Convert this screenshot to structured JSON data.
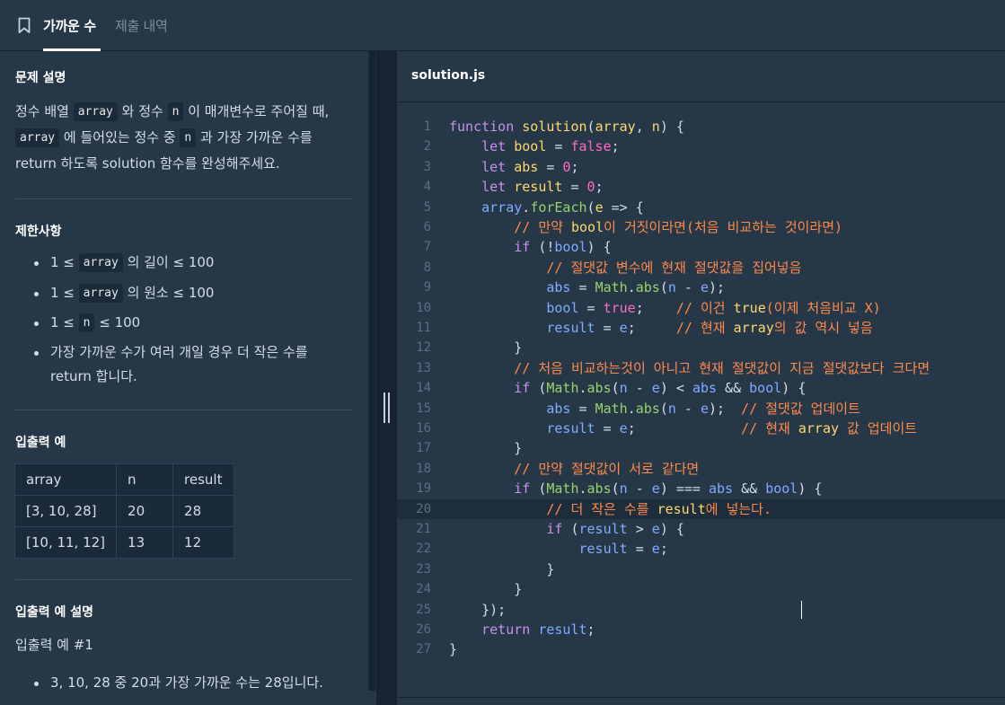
{
  "tabs": {
    "active": "가까운 수",
    "inactive": "제출 내역"
  },
  "problem": {
    "desc_title": "문제 설명",
    "desc_line1": [
      "정수 배열 ",
      "array",
      " 와 정수 ",
      "n",
      " 이 매개변수로 주어질 때,"
    ],
    "desc_line2": [
      "array",
      " 에 들어있는 정수 중 ",
      "n",
      " 과 가장 가까운 수를"
    ],
    "desc_line3": "return 하도록 solution 함수를 완성해주세요.",
    "constraints_title": "제한사항",
    "c1": [
      "1 ≤ ",
      "array",
      " 의 길이 ≤ 100"
    ],
    "c2": [
      "1 ≤ ",
      "array",
      " 의 원소 ≤ 100"
    ],
    "c3": [
      "1 ≤ ",
      "n",
      " ≤ 100"
    ],
    "c4a": "가장 가까운 수가 여러 개일 경우 더 작은 수를",
    "c4b": "return 합니다.",
    "io_title": "입출력 예",
    "io_table": [
      [
        "array",
        "n",
        "result"
      ],
      [
        "[3, 10, 28]",
        "20",
        "28"
      ],
      [
        "[10, 11, 12]",
        "13",
        "12"
      ]
    ],
    "io_expl_title": "입출력 예 설명",
    "io_expl_sub": "입출력 예 #1",
    "io_expl_item": "3, 10, 28 중 20과 가장 가까운 수는 28입니다."
  },
  "editor": {
    "file_name": "solution.js",
    "active_line": 20,
    "colors": {
      "keyword": "#c792ea",
      "function": "#ffd86e",
      "param": "#ffd86e",
      "var": "#ffd86e",
      "boolean": "#ff6bc1",
      "number": "#ff6bc1",
      "comment": "#ff8a4c",
      "builtin": "#9ad36a",
      "ident": "#82aaff",
      "plain": "#d5dde6"
    },
    "lines": [
      [
        [
          "kw",
          "function"
        ],
        [
          "pl",
          " "
        ],
        [
          "fn",
          "solution"
        ],
        [
          "pl",
          "("
        ],
        [
          "pa",
          "array"
        ],
        [
          "pl",
          ", "
        ],
        [
          "pa",
          "n"
        ],
        [
          "pl",
          ") {"
        ]
      ],
      [
        [
          "pl",
          "    "
        ],
        [
          "kw",
          "let"
        ],
        [
          "pl",
          " "
        ],
        [
          "va",
          "bool"
        ],
        [
          "pl",
          " = "
        ],
        [
          "bo",
          "false"
        ],
        [
          "pl",
          ";"
        ]
      ],
      [
        [
          "pl",
          "    "
        ],
        [
          "kw",
          "let"
        ],
        [
          "pl",
          " "
        ],
        [
          "va",
          "abs"
        ],
        [
          "pl",
          " = "
        ],
        [
          "nu",
          "0"
        ],
        [
          "pl",
          ";"
        ]
      ],
      [
        [
          "pl",
          "    "
        ],
        [
          "kw",
          "let"
        ],
        [
          "pl",
          " "
        ],
        [
          "va",
          "result"
        ],
        [
          "pl",
          " = "
        ],
        [
          "nu",
          "0"
        ],
        [
          "pl",
          ";"
        ]
      ],
      [
        [
          "pl",
          "    "
        ],
        [
          "id",
          "array"
        ],
        [
          "pl",
          "."
        ],
        [
          "bi",
          "forEach"
        ],
        [
          "pl",
          "("
        ],
        [
          "pa",
          "e"
        ],
        [
          "pl",
          " => {"
        ]
      ],
      [
        [
          "pl",
          "        "
        ],
        [
          "co",
          "// 만약 "
        ],
        [
          "va",
          "bool"
        ],
        [
          "co",
          "이 거짓이라면(처음 비교하는 것이라면)"
        ]
      ],
      [
        [
          "pl",
          "        "
        ],
        [
          "kw",
          "if"
        ],
        [
          "pl",
          " (!"
        ],
        [
          "id",
          "bool"
        ],
        [
          "pl",
          ") {"
        ]
      ],
      [
        [
          "pl",
          "            "
        ],
        [
          "co",
          "// 절댓값 변수에 현재 절댓값을 집어넣음"
        ]
      ],
      [
        [
          "pl",
          "            "
        ],
        [
          "id",
          "abs"
        ],
        [
          "pl",
          " = "
        ],
        [
          "bi",
          "Math"
        ],
        [
          "pl",
          "."
        ],
        [
          "bi",
          "abs"
        ],
        [
          "pl",
          "("
        ],
        [
          "id",
          "n"
        ],
        [
          "pl",
          " - "
        ],
        [
          "id",
          "e"
        ],
        [
          "pl",
          ");"
        ]
      ],
      [
        [
          "pl",
          "            "
        ],
        [
          "id",
          "bool"
        ],
        [
          "pl",
          " = "
        ],
        [
          "bo",
          "true"
        ],
        [
          "pl",
          ";    "
        ],
        [
          "co",
          "// 이건 "
        ],
        [
          "va",
          "true"
        ],
        [
          "co",
          "(이제 처음비교 X)"
        ]
      ],
      [
        [
          "pl",
          "            "
        ],
        [
          "id",
          "result"
        ],
        [
          "pl",
          " = "
        ],
        [
          "id",
          "e"
        ],
        [
          "pl",
          ";     "
        ],
        [
          "co",
          "// 현재 "
        ],
        [
          "va",
          "array"
        ],
        [
          "co",
          "의 값 역시 넣음"
        ]
      ],
      [
        [
          "pl",
          "        }"
        ]
      ],
      [
        [
          "pl",
          "        "
        ],
        [
          "co",
          "// 처음 비교하는것이 아니고 현재 절댓값이 지금 절댓값보다 크다면"
        ]
      ],
      [
        [
          "pl",
          "        "
        ],
        [
          "kw",
          "if"
        ],
        [
          "pl",
          " ("
        ],
        [
          "bi",
          "Math"
        ],
        [
          "pl",
          "."
        ],
        [
          "bi",
          "abs"
        ],
        [
          "pl",
          "("
        ],
        [
          "id",
          "n"
        ],
        [
          "pl",
          " - "
        ],
        [
          "id",
          "e"
        ],
        [
          "pl",
          ") < "
        ],
        [
          "id",
          "abs"
        ],
        [
          "pl",
          " && "
        ],
        [
          "id",
          "bool"
        ],
        [
          "pl",
          ") {"
        ]
      ],
      [
        [
          "pl",
          "            "
        ],
        [
          "id",
          "abs"
        ],
        [
          "pl",
          " = "
        ],
        [
          "bi",
          "Math"
        ],
        [
          "pl",
          "."
        ],
        [
          "bi",
          "abs"
        ],
        [
          "pl",
          "("
        ],
        [
          "id",
          "n"
        ],
        [
          "pl",
          " - "
        ],
        [
          "id",
          "e"
        ],
        [
          "pl",
          ");  "
        ],
        [
          "co",
          "// 절댓값 업데이트"
        ]
      ],
      [
        [
          "pl",
          "            "
        ],
        [
          "id",
          "result"
        ],
        [
          "pl",
          " = "
        ],
        [
          "id",
          "e"
        ],
        [
          "pl",
          ";             "
        ],
        [
          "co",
          "// 현재 "
        ],
        [
          "va",
          "array"
        ],
        [
          "co",
          " 값 업데이트"
        ]
      ],
      [
        [
          "pl",
          "        }"
        ]
      ],
      [
        [
          "pl",
          "        "
        ],
        [
          "co",
          "// 만약 절댓값이 서로 같다면"
        ]
      ],
      [
        [
          "pl",
          "        "
        ],
        [
          "kw",
          "if"
        ],
        [
          "pl",
          " ("
        ],
        [
          "bi",
          "Math"
        ],
        [
          "pl",
          "."
        ],
        [
          "bi",
          "abs"
        ],
        [
          "pl",
          "("
        ],
        [
          "id",
          "n"
        ],
        [
          "pl",
          " - "
        ],
        [
          "id",
          "e"
        ],
        [
          "pl",
          ") === "
        ],
        [
          "id",
          "abs"
        ],
        [
          "pl",
          " && "
        ],
        [
          "id",
          "bool"
        ],
        [
          "pl",
          ") {"
        ]
      ],
      [
        [
          "pl",
          "            "
        ],
        [
          "co",
          "// 더 작은 수를 "
        ],
        [
          "va",
          "result"
        ],
        [
          "co",
          "에 넣는다."
        ]
      ],
      [
        [
          "pl",
          "            "
        ],
        [
          "kw",
          "if"
        ],
        [
          "pl",
          " ("
        ],
        [
          "id",
          "result"
        ],
        [
          "pl",
          " > "
        ],
        [
          "id",
          "e"
        ],
        [
          "pl",
          ") {"
        ]
      ],
      [
        [
          "pl",
          "                "
        ],
        [
          "id",
          "result"
        ],
        [
          "pl",
          " = "
        ],
        [
          "id",
          "e"
        ],
        [
          "pl",
          ";"
        ]
      ],
      [
        [
          "pl",
          "            }"
        ]
      ],
      [
        [
          "pl",
          "        }"
        ]
      ],
      [
        [
          "pl",
          "    });"
        ]
      ],
      [
        [
          "pl",
          "    "
        ],
        [
          "kw",
          "return"
        ],
        [
          "pl",
          " "
        ],
        [
          "id",
          "result"
        ],
        [
          "pl",
          ";"
        ]
      ],
      [
        [
          "pl",
          "}"
        ]
      ]
    ]
  }
}
